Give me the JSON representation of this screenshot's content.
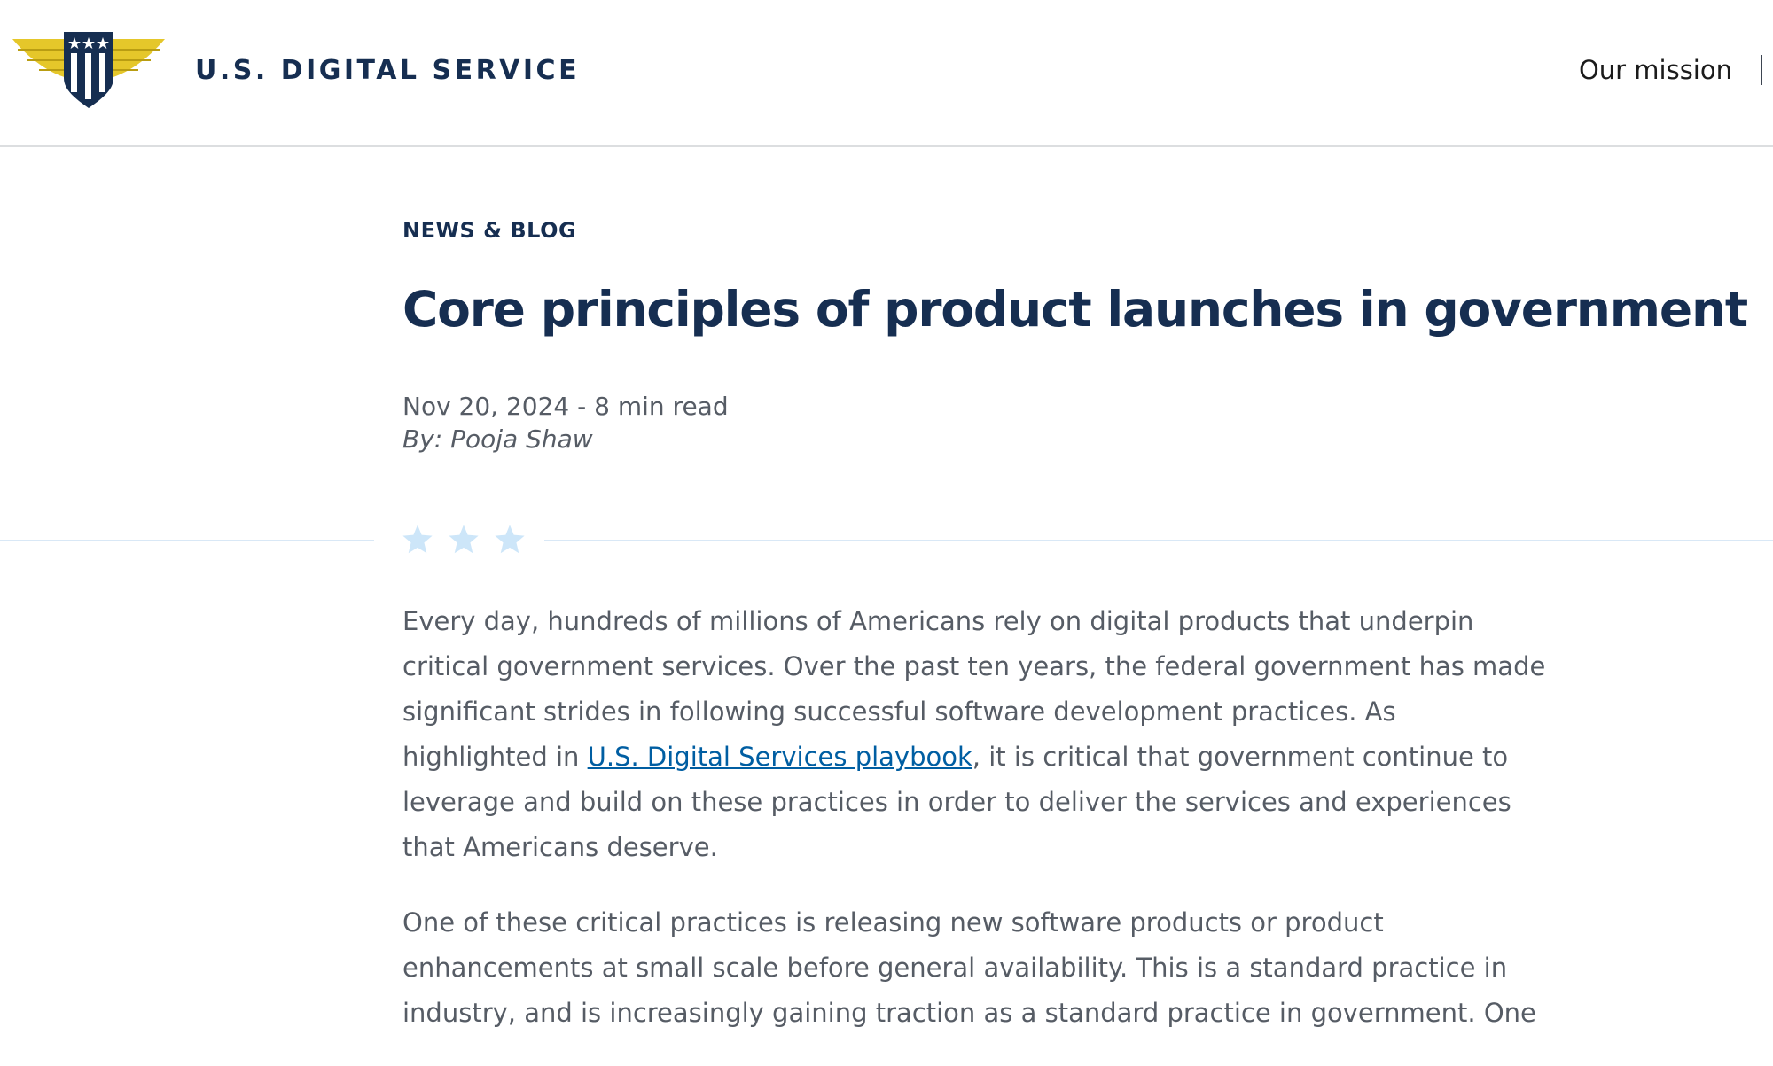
{
  "header": {
    "logo_text": "U.S. DIGITAL SERVICE",
    "nav": [
      {
        "label": "Our mission"
      }
    ]
  },
  "article": {
    "eyebrow": "NEWS & BLOG",
    "title": "Core principles of product launches in government",
    "date_read": "Nov 20, 2024 - 8 min read",
    "byline": "By: Pooja Shaw",
    "p1_before": "Every day, hundreds of millions of Americans rely on digital products that underpin critical government services. Over the past ten years, the federal government has made significant strides in following successful software development practices. As highlighted in ",
    "p1_link": "U.S. Digital Services playbook",
    "p1_after": ", it is critical that government continue to leverage and build on these practices in order to deliver the services and experiences that Americans deserve.",
    "p2": "One of these critical practices is releasing new software products or product enhancements at small scale before general availability. This is a standard practice in industry, and is increasingly gaining traction as a standard practice in government. One"
  },
  "colors": {
    "navy": "#162e51",
    "gold": "#e5c72a",
    "gold_dark": "#c7ac1a",
    "link": "#005ea2",
    "star": "#cde6f9",
    "body_text": "#565c65"
  },
  "icons": {
    "logo": "usds-winged-shield-logo",
    "divider": "three-stars-icon"
  }
}
